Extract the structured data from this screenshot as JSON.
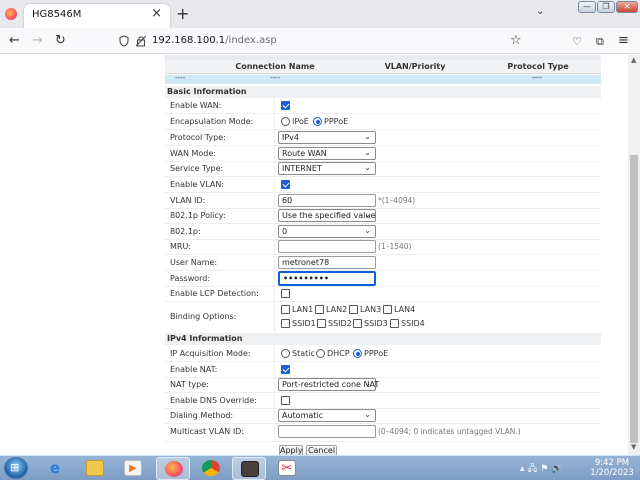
{
  "browser": {
    "tab_title": "HG8546M",
    "tab_close": "×",
    "new_tab": "+",
    "list_tabs": "⌄",
    "url_host": "192.168.100.1",
    "url_path": "/index.asp",
    "window_controls": {
      "minimize": "—",
      "maximize": "❐",
      "close": "✕"
    }
  },
  "connection_table": {
    "headers": [
      "Connection Name",
      "VLAN/Priority",
      "Protocol Type"
    ],
    "row": [
      "----",
      "----",
      "----"
    ]
  },
  "basic": {
    "section_title": "Basic Information",
    "enable_wan": {
      "label": "Enable WAN:",
      "checked": true
    },
    "encapsulation": {
      "label": "Encapsulation Mode:",
      "options": [
        "IPoE",
        "PPPoE"
      ],
      "selected": "PPPoE"
    },
    "protocol_type": {
      "label": "Protocol Type:",
      "value": "IPv4"
    },
    "wan_mode": {
      "label": "WAN Mode:",
      "value": "Route WAN"
    },
    "service_type": {
      "label": "Service Type:",
      "value": "INTERNET"
    },
    "enable_vlan": {
      "label": "Enable VLAN:",
      "checked": true
    },
    "vlan_id": {
      "label": "VLAN ID:",
      "value": "60",
      "hint": "*(1–4094)"
    },
    "policy_8021p": {
      "label": "802.1p Policy:",
      "value": "Use the specified value"
    },
    "value_8021p": {
      "label": "802.1p:",
      "value": "0"
    },
    "mru": {
      "label": "MRU:",
      "value": "",
      "hint": "(1–1540)"
    },
    "user_name": {
      "label": "User Name:",
      "value": "metronet78"
    },
    "password": {
      "label": "Password:",
      "value": "•••••••••"
    },
    "enable_lcp": {
      "label": "Enable LCP Detection:",
      "checked": false
    },
    "binding": {
      "label": "Binding Options:",
      "lan": [
        "LAN1",
        "LAN2",
        "LAN3",
        "LAN4"
      ],
      "ssid": [
        "SSID1",
        "SSID2",
        "SSID3",
        "SSID4"
      ]
    }
  },
  "ipv4": {
    "section_title": "IPv4 Information",
    "acquisition": {
      "label": "IP Acquisition Mode:",
      "options": [
        "Static",
        "DHCP",
        "PPPoE"
      ],
      "selected": "PPPoE"
    },
    "enable_nat": {
      "label": "Enable NAT:",
      "checked": true
    },
    "nat_type": {
      "label": "NAT type:",
      "value": "Port-restricted cone NAT"
    },
    "dns_override": {
      "label": "Enable DNS Override:",
      "checked": false
    },
    "dialing": {
      "label": "Dialing Method:",
      "value": "Automatic"
    },
    "multicast": {
      "label": "Multicast VLAN ID:",
      "value": "",
      "hint": "(0–4094; 0 indicates untagged VLAN.)"
    }
  },
  "actions": {
    "apply": "Apply",
    "cancel": "Cancel"
  },
  "taskbar": {
    "time": "9:42 PM",
    "date": "1/20/2023",
    "tray_glyphs": "▴ 🖧 ⚑ 🔊"
  },
  "colors": {
    "accent": "#1a5ed1",
    "selected_row": "#cfe9f7",
    "taskbar": "#8aa9cf"
  }
}
